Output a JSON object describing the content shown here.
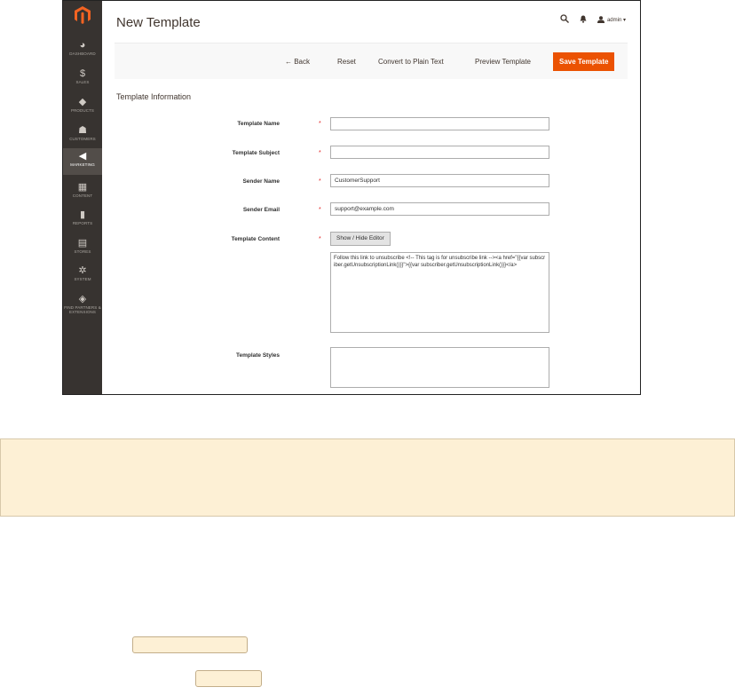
{
  "page": {
    "title": "New Template"
  },
  "header": {
    "search_icon": "search-icon",
    "bell_icon": "bell-icon",
    "user_icon": "user-icon",
    "user_label": "admin ▾"
  },
  "sidebar": {
    "logo_icon": "magento-logo",
    "items": [
      {
        "label": "DASHBOARD",
        "icon": "dashboard-icon",
        "glyph": "◕"
      },
      {
        "label": "SALES",
        "icon": "dollar-icon",
        "glyph": "$"
      },
      {
        "label": "PRODUCTS",
        "icon": "cube-icon",
        "glyph": "◆"
      },
      {
        "label": "CUSTOMERS",
        "icon": "person-icon",
        "glyph": "☗"
      },
      {
        "label": "MARKETING",
        "icon": "megaphone-icon",
        "glyph": "◀"
      },
      {
        "label": "CONTENT",
        "icon": "layout-icon",
        "glyph": "▦"
      },
      {
        "label": "REPORTS",
        "icon": "bar-chart-icon",
        "glyph": "▮"
      },
      {
        "label": "STORES",
        "icon": "store-icon",
        "glyph": "▤"
      },
      {
        "label": "SYSTEM",
        "icon": "gear-icon",
        "glyph": "✲"
      },
      {
        "label": "FIND PARTNERS & EXTENSIONS",
        "icon": "partners-icon",
        "glyph": "◈"
      }
    ]
  },
  "actions": {
    "back": "← Back",
    "reset": "Reset",
    "convert": "Convert to Plain Text",
    "preview": "Preview Template",
    "save": "Save Template"
  },
  "form": {
    "section_title": "Template Information",
    "required_mark": "*",
    "template_name": {
      "label": "Template Name",
      "value": ""
    },
    "template_subject": {
      "label": "Template Subject",
      "value": ""
    },
    "sender_name": {
      "label": "Sender Name",
      "value": "CustomerSupport"
    },
    "sender_email": {
      "label": "Sender Email",
      "value": "support@example.com"
    },
    "template_content": {
      "label": "Template Content",
      "toggle_label": "Show / Hide Editor",
      "value": "Follow this link to unsubscribe <!-- This tag is for unsubscribe link --><a href=\"{{var subscriber.getUnsubscriptionLink()}}\">{{var subscriber.getUnsubscriptionLink()}}</a>"
    },
    "template_styles": {
      "label": "Template Styles",
      "value": ""
    }
  },
  "colors": {
    "accent": "#eb5202",
    "sidebar": "#373330",
    "notice_bg": "#fdf0d5"
  }
}
